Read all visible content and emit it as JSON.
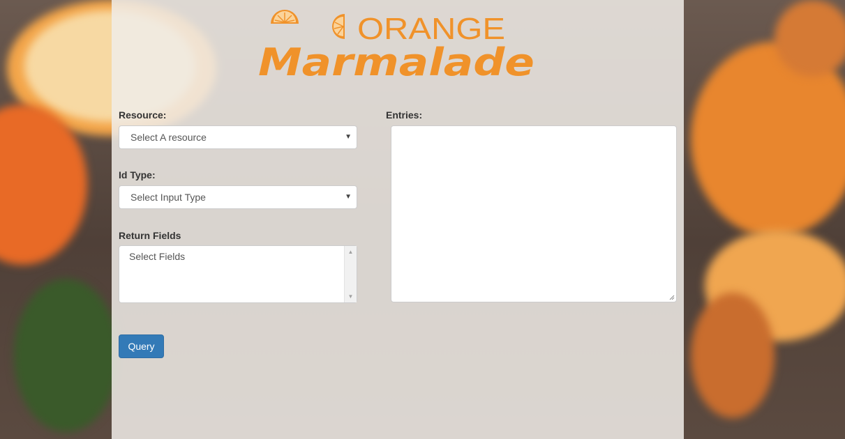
{
  "logo": {
    "line1": "ORANGE",
    "line2": "Marmalade",
    "color": "#f0922a"
  },
  "form": {
    "resource": {
      "label": "Resource:",
      "value": "Select A resource"
    },
    "id_type": {
      "label": "Id Type:",
      "value": "Select Input Type"
    },
    "return_fields": {
      "label": "Return Fields",
      "placeholder": "Select Fields"
    },
    "entries": {
      "label": "Entries:",
      "value": ""
    },
    "query_button": "Query"
  },
  "colors": {
    "accent": "#337ab7",
    "panel": "#f0ece8"
  }
}
